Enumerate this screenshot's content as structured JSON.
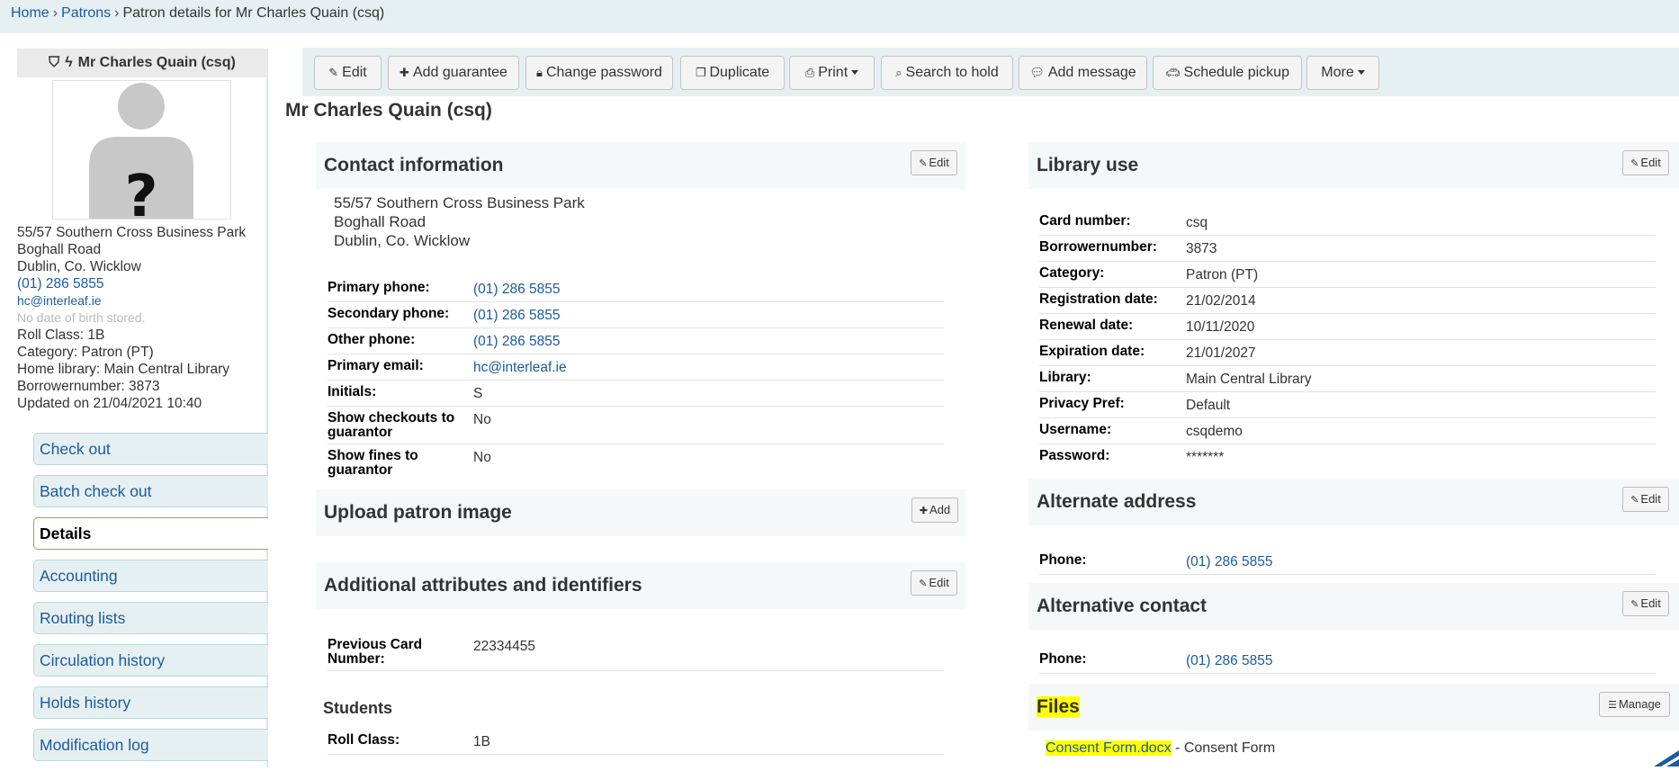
{
  "breadcrumb": {
    "home": "Home",
    "patrons": "Patrons",
    "current": "Patron details for Mr Charles Quain (csq)",
    "separator": "›"
  },
  "sidebar": {
    "patron_name": "Mr Charles Quain (csq)",
    "address_line1": "55/57 Southern Cross Business Park",
    "address_line2": "Boghall Road",
    "address_line3": "Dublin, Co. Wicklow",
    "phone": "(01) 286 5855",
    "email": "hc@interleaf.ie",
    "dob": "No date of birth stored.",
    "roll_class": "Roll Class: 1B",
    "category": "Category: Patron (PT)",
    "home_library": "Home library: Main Central Library",
    "borrowernumber": "Borrowernumber: 3873",
    "updated": "Updated on 21/04/2021 10:40",
    "nav": [
      {
        "label": "Check out"
      },
      {
        "label": "Batch check out"
      },
      {
        "label": "Details"
      },
      {
        "label": "Accounting"
      },
      {
        "label": "Routing lists"
      },
      {
        "label": "Circulation history"
      },
      {
        "label": "Holds history"
      },
      {
        "label": "Modification log"
      }
    ]
  },
  "toolbar": {
    "edit": "Edit",
    "add_guarantee": "Add guarantee",
    "change_password": "Change password",
    "duplicate": "Duplicate",
    "print": "Print",
    "search_to_hold": "Search to hold",
    "add_message": "Add message",
    "schedule_pickup": "Schedule pickup",
    "more": "More"
  },
  "page_title": "Mr Charles Quain (csq)",
  "contact": {
    "heading": "Contact information",
    "edit": "Edit",
    "address_line1": "55/57 Southern Cross Business Park",
    "address_line2": "Boghall Road",
    "address_line3": "Dublin, Co. Wicklow",
    "rows": [
      {
        "label": "Primary phone:",
        "value": "(01) 286 5855"
      },
      {
        "label": "Secondary phone:",
        "value": "(01) 286 5855"
      },
      {
        "label": "Other phone:",
        "value": "(01) 286 5855"
      },
      {
        "label": "Primary email:",
        "value": "hc@interleaf.ie"
      },
      {
        "label": "Initials:",
        "value": "S"
      },
      {
        "label": "Show checkouts to guarantor",
        "value": "No"
      },
      {
        "label": "Show fines to guarantor",
        "value": "No"
      }
    ]
  },
  "upload": {
    "heading": "Upload patron image",
    "add": "Add"
  },
  "attributes": {
    "heading": "Additional attributes and identifiers",
    "edit": "Edit",
    "rows": [
      {
        "label": "Previous Card Number:",
        "value": "22334455"
      }
    ],
    "students_heading": "Students",
    "students_rows": [
      {
        "label": "Roll Class:",
        "value": "1B"
      }
    ]
  },
  "library_use": {
    "heading": "Library use",
    "edit": "Edit",
    "rows": [
      {
        "label": "Card number:",
        "value": "csq"
      },
      {
        "label": "Borrowernumber:",
        "value": "3873"
      },
      {
        "label": "Category:",
        "value": "Patron (PT)"
      },
      {
        "label": "Registration date:",
        "value": "21/02/2014"
      },
      {
        "label": "Renewal date:",
        "value": "10/11/2020"
      },
      {
        "label": "Expiration date:",
        "value": "21/01/2027"
      },
      {
        "label": "Library:",
        "value": "Main Central Library"
      },
      {
        "label": "Privacy Pref:",
        "value": "Default"
      },
      {
        "label": "Username:",
        "value": "csqdemo"
      },
      {
        "label": "Password:",
        "value": "*******"
      }
    ]
  },
  "alternate_address": {
    "heading": "Alternate address",
    "edit": "Edit",
    "rows": [
      {
        "label": "Phone:",
        "value": "(01) 286 5855"
      }
    ]
  },
  "alternative_contact": {
    "heading": "Alternative contact",
    "edit": "Edit",
    "rows": [
      {
        "label": "Phone:",
        "value": "(01) 286 5855"
      }
    ]
  },
  "files": {
    "heading": "Files",
    "manage": "Manage",
    "file_name": "Consent Form.docx",
    "file_desc": " - Consent Form"
  },
  "colors": {
    "link": "#1c5b9c",
    "breadcrumb_bg": "#e6f0f2",
    "active_border": "#6fbf3a",
    "highlight": "#ffff00"
  }
}
